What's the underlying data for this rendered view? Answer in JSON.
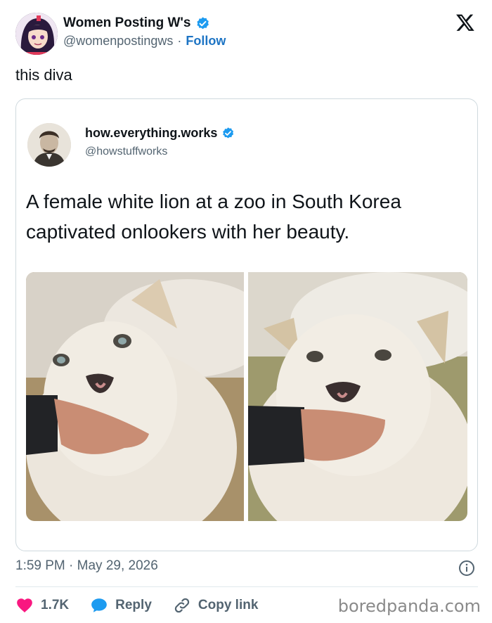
{
  "author": {
    "display_name": "Women Posting W's",
    "handle": "@womenpostingws",
    "separator": "·",
    "follow_label": "Follow"
  },
  "tweet": {
    "text": "this diva"
  },
  "quoted": {
    "display_name": "how.everything.works",
    "handle": "@howstuffworks",
    "text": "A female white lion at a zoo in South Korea captivated onlookers with her beauty."
  },
  "meta": {
    "timestamp": "1:59 PM · May 29, 2026"
  },
  "actions": {
    "likes": "1.7K",
    "reply_label": "Reply",
    "copy_link_label": "Copy link"
  },
  "watermark": "boredpanda.com",
  "colors": {
    "verified": "#1d9bf0",
    "like": "#f91880",
    "reply": "#1d9bf0",
    "link": "#1d74c4"
  },
  "icons": [
    "verified-icon",
    "x-logo-icon",
    "info-icon",
    "heart-icon",
    "reply-bubble-icon",
    "link-icon"
  ]
}
